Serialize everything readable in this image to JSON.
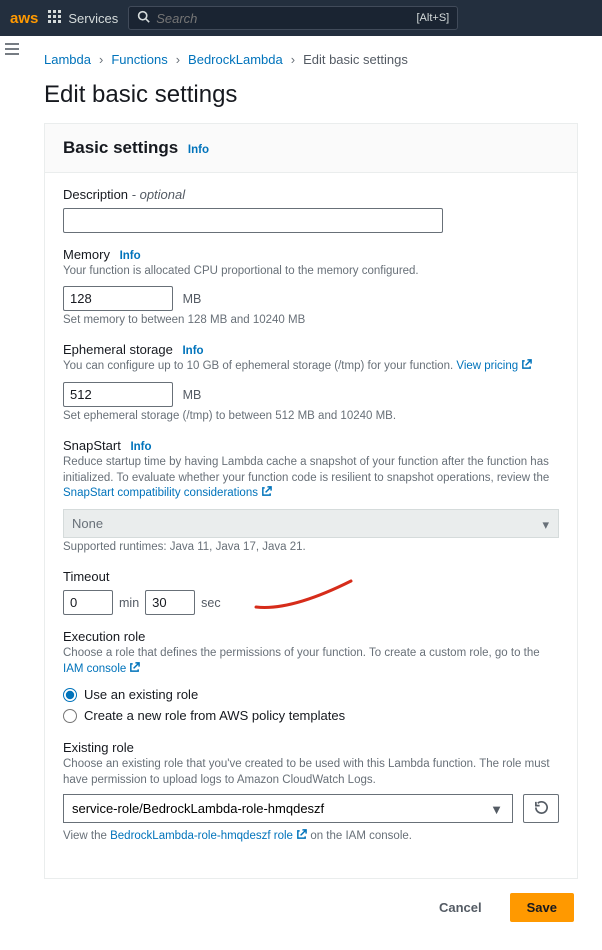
{
  "topbar": {
    "logo": "aws",
    "services_label": "Services",
    "search_placeholder": "Search",
    "shortcut": "[Alt+S]"
  },
  "breadcrumb": {
    "lambda": "Lambda",
    "functions": "Functions",
    "fn_name": "BedrockLambda",
    "current": "Edit basic settings"
  },
  "page_title": "Edit basic settings",
  "card": {
    "title": "Basic settings",
    "info": "Info"
  },
  "description": {
    "label": "Description",
    "optional": " - optional",
    "value": ""
  },
  "memory": {
    "label": "Memory",
    "info": "Info",
    "help": "Your function is allocated CPU proportional to the memory configured.",
    "value": "128",
    "unit": "MB",
    "hint": "Set memory to between 128 MB and 10240 MB"
  },
  "storage": {
    "label": "Ephemeral storage",
    "info": "Info",
    "help_pre": "You can configure up to 10 GB of ephemeral storage (/tmp) for your function. ",
    "help_link": "View pricing",
    "value": "512",
    "unit": "MB",
    "hint": "Set ephemeral storage (/tmp) to between 512 MB and 10240 MB."
  },
  "snapstart": {
    "label": "SnapStart",
    "info": "Info",
    "help_pre": "Reduce startup time by having Lambda cache a snapshot of your function after the function has initialized. To evaluate whether your function code is resilient to snapshot operations, review the ",
    "help_link": "SnapStart compatibility considerations",
    "value": "None",
    "hint": "Supported runtimes: Java 11, Java 17, Java 21."
  },
  "timeout": {
    "label": "Timeout",
    "min_value": "0",
    "min_unit": "min",
    "sec_value": "30",
    "sec_unit": "sec"
  },
  "exec_role": {
    "label": "Execution role",
    "help_pre": "Choose a role that defines the permissions of your function. To create a custom role, go to the ",
    "help_link": "IAM console",
    "opt_existing": "Use an existing role",
    "opt_new": "Create a new role from AWS policy templates"
  },
  "existing_role": {
    "label": "Existing role",
    "help": "Choose an existing role that you've created to be used with this Lambda function. The role must have permission to upload logs to Amazon CloudWatch Logs.",
    "value": "service-role/BedrockLambda-role-hmqdeszf",
    "view_pre": "View the ",
    "view_link": "BedrockLambda-role-hmqdeszf role",
    "view_post": " on the IAM console."
  },
  "footer": {
    "cancel": "Cancel",
    "save": "Save"
  }
}
